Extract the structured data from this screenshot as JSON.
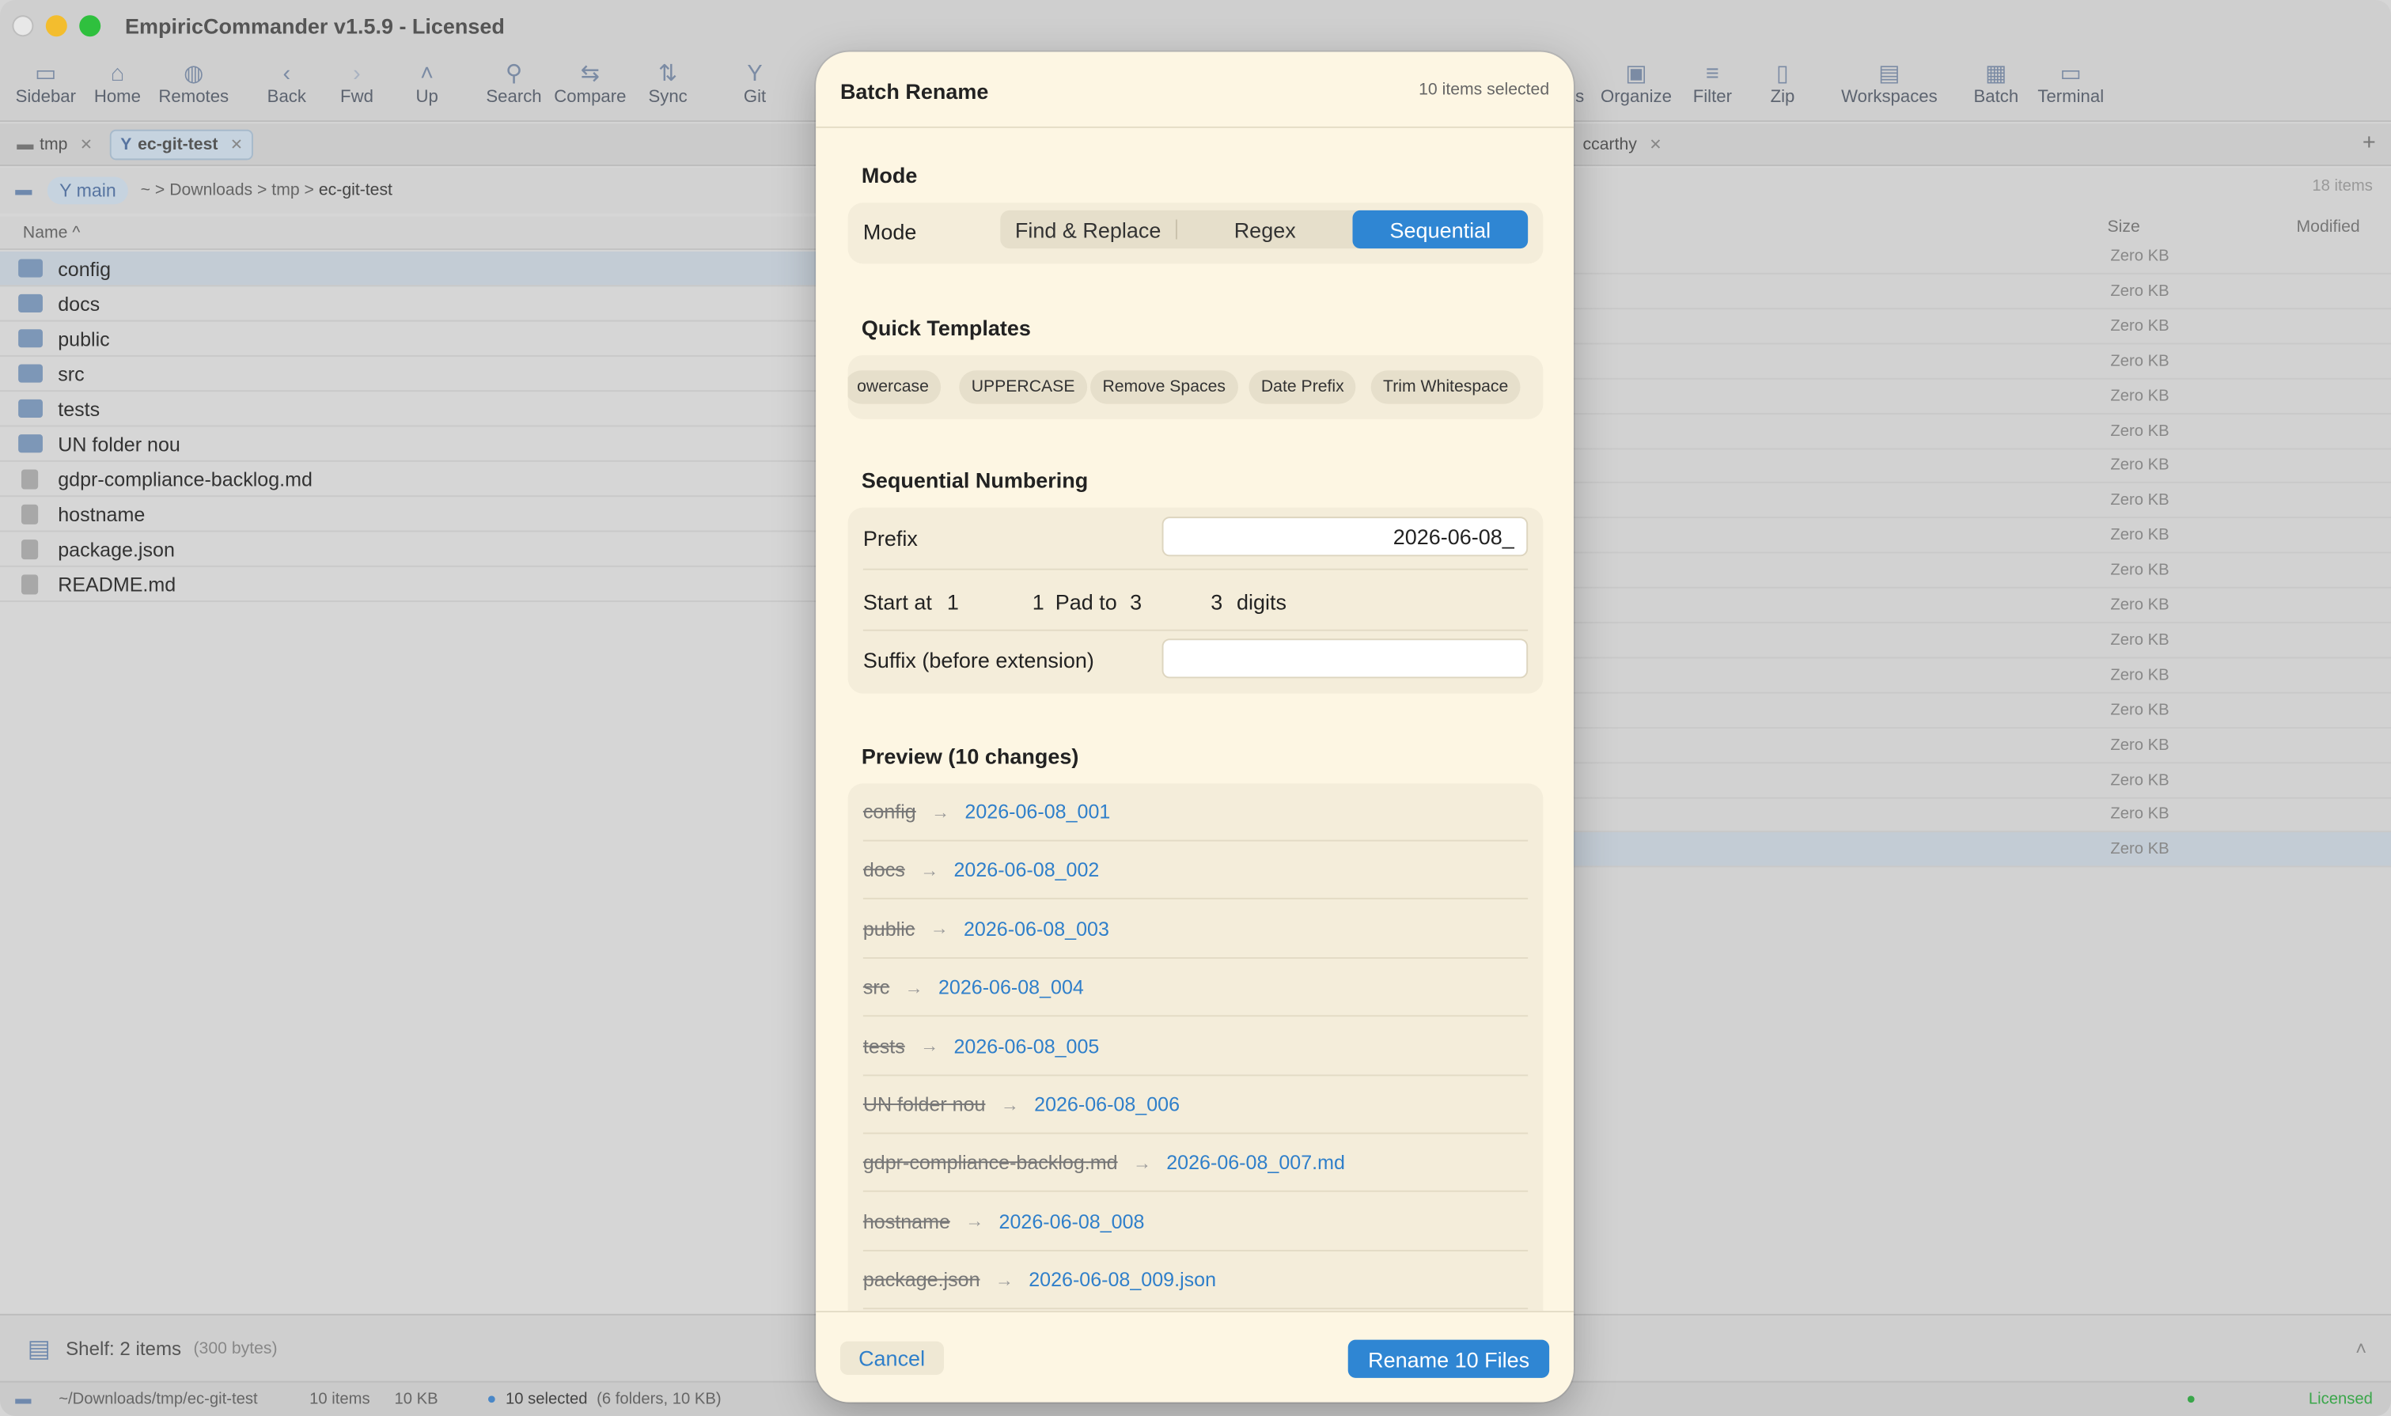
{
  "window": {
    "title": "EmpiricCommander v1.5.9 - Licensed"
  },
  "toolbar": {
    "items": [
      {
        "label": "Sidebar",
        "icon": "sidebar-icon",
        "glyph": "▭"
      },
      {
        "label": "Home",
        "icon": "home-icon",
        "glyph": "⌂"
      },
      {
        "label": "Remotes",
        "icon": "globe-icon",
        "glyph": "◍"
      },
      {
        "label": "Back",
        "icon": "chevron-left-icon",
        "glyph": "‹"
      },
      {
        "label": "Fwd",
        "icon": "chevron-right-icon",
        "glyph": "›"
      },
      {
        "label": "Up",
        "icon": "chevron-up-icon",
        "glyph": "˄"
      },
      {
        "label": "Search",
        "icon": "search-icon",
        "glyph": "⚲"
      },
      {
        "label": "Compare",
        "icon": "compare-icon",
        "glyph": "⇆"
      },
      {
        "label": "Sync",
        "icon": "sync-icon",
        "glyph": "⇅"
      },
      {
        "label": "Git",
        "icon": "git-branch-icon",
        "glyph": "Y"
      },
      {
        "label": "s",
        "icon": "partial-hidden",
        "glyph": ""
      },
      {
        "label": "Organize",
        "icon": "organize-icon",
        "glyph": "▣"
      },
      {
        "label": "Filter",
        "icon": "filter-icon",
        "glyph": "≡"
      },
      {
        "label": "Zip",
        "icon": "zip-icon",
        "glyph": "▯"
      },
      {
        "label": "Workspaces",
        "icon": "workspaces-icon",
        "glyph": "▤"
      },
      {
        "label": "Batch",
        "icon": "batch-icon",
        "glyph": "▦"
      },
      {
        "label": "Terminal",
        "icon": "terminal-icon",
        "glyph": "▭"
      }
    ]
  },
  "left_pane": {
    "tabs": [
      {
        "label": "tmp",
        "active": false
      },
      {
        "label": "ec-git-test",
        "active": true
      }
    ],
    "branch": "main",
    "breadcrumb": [
      "~",
      ">",
      "Downloads",
      ">",
      "tmp",
      ">",
      "ec-git-test"
    ],
    "column_name": "Name ^",
    "files": [
      {
        "name": "config",
        "type": "folder"
      },
      {
        "name": "docs",
        "type": "folder"
      },
      {
        "name": "public",
        "type": "folder"
      },
      {
        "name": "src",
        "type": "folder"
      },
      {
        "name": "tests",
        "type": "folder"
      },
      {
        "name": "UN folder nou",
        "type": "folder"
      },
      {
        "name": "gdpr-compliance-backlog.md",
        "type": "file"
      },
      {
        "name": "hostname",
        "type": "file"
      },
      {
        "name": "package.json",
        "type": "file"
      },
      {
        "name": "README.md",
        "type": "file"
      }
    ]
  },
  "right_pane": {
    "tab_label": "ccarthy",
    "item_count": "18 items",
    "col_size": "Size",
    "col_modified": "Modified",
    "sizes": [
      "Zero KB",
      "Zero KB",
      "Zero KB",
      "Zero KB",
      "Zero KB",
      "Zero KB",
      "Zero KB",
      "Zero KB",
      "Zero KB",
      "Zero KB",
      "Zero KB",
      "Zero KB",
      "Zero KB",
      "Zero KB",
      "Zero KB",
      "Zero KB",
      "Zero KB",
      "Zero KB"
    ],
    "add_tab": "+"
  },
  "shelf": {
    "label": "Shelf: 2 items",
    "size": "(300 bytes)"
  },
  "status": {
    "path": "~/Downloads/tmp/ec-git-test",
    "items": "10 items",
    "size": "10 KB",
    "selected": "10 selected",
    "selected_detail": "(6 folders, 10 KB)",
    "license": "Licensed"
  },
  "dialog": {
    "title": "Batch Rename",
    "count": "10 items selected",
    "mode_section": "Mode",
    "mode_label": "Mode",
    "modes": [
      "Find & Replace",
      "Regex",
      "Sequential"
    ],
    "active_mode": "Sequential",
    "templates_section": "Quick Templates",
    "templates": [
      "owercase",
      "UPPERCASE",
      "Remove Spaces",
      "Date Prefix",
      "Trim Whitespace"
    ],
    "seq_section": "Sequential Numbering",
    "prefix_label": "Prefix",
    "prefix_value": "2026-06-08_",
    "start_label": "Start at",
    "start_value": "1",
    "start_stepper": "1",
    "pad_label": "Pad to",
    "pad_value": "3",
    "pad_stepper": "3",
    "digits_label": "digits",
    "suffix_label": "Suffix (before extension)",
    "suffix_value": "",
    "preview_section": "Preview (10 changes)",
    "preview": [
      {
        "old": "config",
        "new": "2026-06-08_001"
      },
      {
        "old": "docs",
        "new": "2026-06-08_002"
      },
      {
        "old": "public",
        "new": "2026-06-08_003"
      },
      {
        "old": "src",
        "new": "2026-06-08_004"
      },
      {
        "old": "tests",
        "new": "2026-06-08_005"
      },
      {
        "old": "UN folder nou",
        "new": "2026-06-08_006"
      },
      {
        "old": "gdpr-compliance-backlog.md",
        "new": "2026-06-08_007.md"
      },
      {
        "old": "hostname",
        "new": "2026-06-08_008"
      },
      {
        "old": "package.json",
        "new": "2026-06-08_009.json"
      }
    ],
    "arrow": "→",
    "cancel": "Cancel",
    "rename": "Rename 10 Files"
  },
  "colors": {
    "accent": "#2f86d3",
    "dialog_bg": "#fdf6e3",
    "card_bg": "#f4edda"
  }
}
